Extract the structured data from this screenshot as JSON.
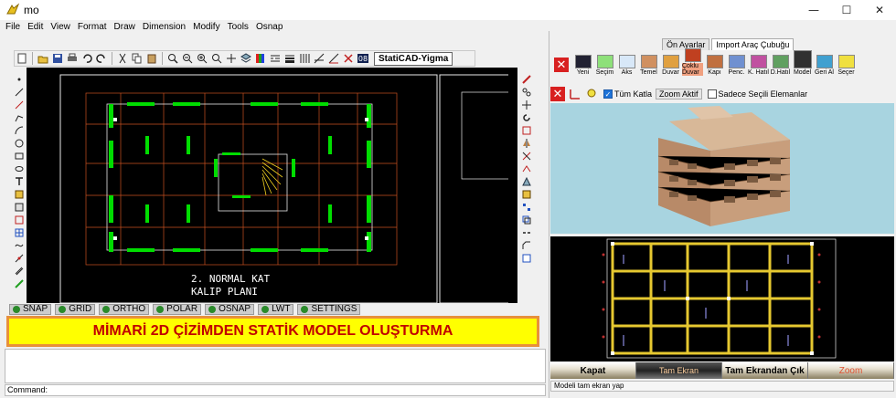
{
  "window": {
    "title": "mo",
    "minimize": "—",
    "maximize": "☐",
    "close": "✕"
  },
  "menu": [
    "File",
    "Edit",
    "View",
    "Format",
    "Draw",
    "Dimension",
    "Modify",
    "Tools",
    "Osnap"
  ],
  "toolbar": {
    "app_label": "StatiCAD-Yigma"
  },
  "drawing": {
    "title_line1": "2. NORMAL KAT",
    "title_line2": "KALIP PLANI"
  },
  "status_buttons": [
    "SNAP",
    "GRID",
    "ORTHO",
    "POLAR",
    "OSNAP",
    "LWT",
    "SETTINGS"
  ],
  "banner": "MİMARİ 2D ÇİZİMDEN STATİK MODEL OLUŞTURMA",
  "command_label": "Command:",
  "right_panel": {
    "tabs": [
      "Ön Ayarlar",
      "Import Araç Çubuğu"
    ],
    "ribbon": [
      "Yeni",
      "Seçim",
      "Aks",
      "Temel",
      "Duvar",
      "Çoklu Duvar",
      "Kapı",
      "Penc.",
      "K. Hatıl",
      "D.Hatıl",
      "Model",
      "Geri Al",
      "Seçer"
    ],
    "tum_katla": "Tüm Katla",
    "zoom_aktif": "Zoom Aktif",
    "sadece": "Sadece Seçili Elemanlar",
    "bottom_buttons": [
      "Kapat",
      "Tam Ekran",
      "Tam Ekrandan Çık",
      "Zoom"
    ],
    "status": "Modeli tam ekran yap"
  },
  "colors": {
    "banner_bg": "#ffff00",
    "banner_border": "#e8903a",
    "banner_text": "#c00000",
    "view3d_bg": "#a8d4e0"
  }
}
